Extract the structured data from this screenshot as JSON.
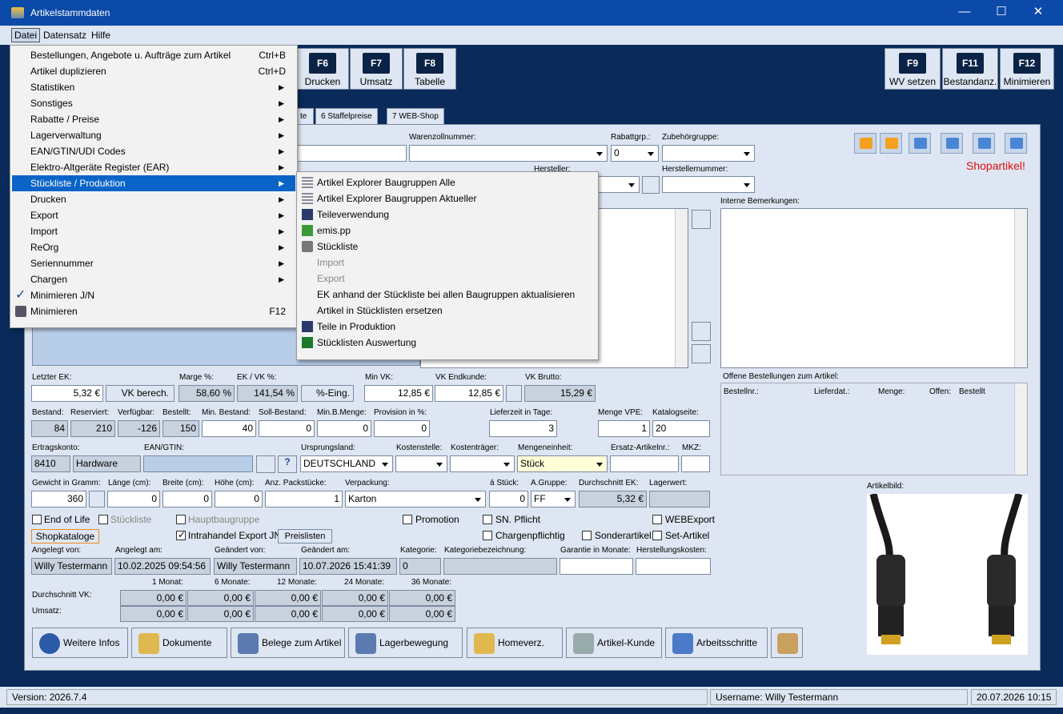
{
  "window": {
    "title": "Artikelstammdaten",
    "minimize": "—",
    "maximize": "☐",
    "close": "✕"
  },
  "menubar": {
    "datei": "Datei",
    "datensatz": "Datensatz",
    "hilfe": "Hilfe"
  },
  "fkeys": [
    {
      "key": "F6",
      "label": "Drucken"
    },
    {
      "key": "F7",
      "label": "Umsatz"
    },
    {
      "key": "F8",
      "label": "Tabelle"
    },
    {
      "key": "F9",
      "label": "WV setzen"
    },
    {
      "key": "F11",
      "label": "Bestandanz."
    },
    {
      "key": "F12",
      "label": "Minimieren"
    }
  ],
  "tabs": [
    "te",
    "6 Staffelpreise",
    "7 WEB-Shop"
  ],
  "shopflag": "Shopartikel!",
  "labels": {
    "warenzoll": "Warenzollnummer:",
    "rabattgrp": "Rabattgrp.:",
    "zubehoer": "Zubehörgruppe:",
    "hersteller": "Hersteller:",
    "herstellernr": "Herstellernummer:",
    "interne": "Interne Bemerkungen:",
    "offene": "Offene Bestellungen zum Artikel:",
    "letzter_ek": "Letzter EK:",
    "marge": "Marge %:",
    "ekvk": "EK / VK %:",
    "minvk": "Min VK:",
    "vkend": "VK Endkunde:",
    "vkbrutto": "VK Brutto:",
    "bestand": "Bestand:",
    "reserviert": "Reserviert:",
    "verfuegbar": "Verfügbar:",
    "bestellt": "Bestellt:",
    "minbestand": "Min. Bestand:",
    "sollbestand": "Soll-Bestand:",
    "minbmenge": "Min.B.Menge:",
    "provision": "Provision in %:",
    "lieferzeit": "Lieferzeit in Tage:",
    "mengevpe": "Menge VPE:",
    "katalogseite": "Katalogseite:",
    "ertragskonto": "Ertragskonto:",
    "ean": "EAN/GTIN:",
    "ursprung": "Ursprungsland:",
    "kostenstelle": "Kostenstelle:",
    "kostentraeger": "Kostenträger:",
    "mengeneinheit": "Mengeneinheit:",
    "ersatz": "Ersatz-Artikelnr.:",
    "mkz": "MKZ:",
    "gewicht": "Gewicht in Gramm:",
    "laenge": "Länge (cm):",
    "breite": "Breite (cm):",
    "hoehe": "Höhe (cm):",
    "packstuecke": "Anz. Packstücke:",
    "verpackung": "Verpackung:",
    "astueck": "á Stück:",
    "agruppe": "A.Gruppe:",
    "durchschnitt": "Durchschnitt EK:",
    "lagerwert": "Lagerwert:",
    "artikelbild": "Artikelbild:",
    "angelegtvon": "Angelegt von:",
    "angelegtam": "Angelegt am:",
    "geaendertvon": "Geändert von:",
    "geaendertam": "Geändert am:",
    "kategorie": "Kategorie:",
    "katbez": "Kategoriebezeichnung:",
    "garantie": "Garantie in Monate:",
    "herstkosten": "Herstellungskosten:",
    "m1": "1 Monat:",
    "m6": "6 Monate:",
    "m12": "12 Monate:",
    "m24": "24 Monate:",
    "m36": "36 Monate:",
    "dvk": "Durchschnitt VK:",
    "umsatz": "Umsatz:"
  },
  "values": {
    "rabatt": "0",
    "letzter_ek": "5,32 €",
    "marge": "58,60 %",
    "ekvk": "141,54 %",
    "minvk": "12,85 €",
    "vkend": "12,85 €",
    "vkbrutto": "15,29 €",
    "bestand": "84",
    "reserviert": "210",
    "verfuegbar": "-126",
    "bestellt": "150",
    "minbestand": "40",
    "sollbestand": "0",
    "minbmenge": "0",
    "provision": "0",
    "lieferzeit": "3",
    "mengevpe": "1",
    "katalogseite": "20",
    "konto": "8410",
    "kontoname": "Hardware",
    "ursprung": "DEUTSCHLAND",
    "mengeneinheit": "Stück",
    "gewicht": "360",
    "laenge": "0",
    "breite": "0",
    "hoehe": "0",
    "packstuecke": "1",
    "verpackung": "Karton",
    "astueck": "0",
    "agruppe": "FF",
    "durchschnitt": "5,32 €",
    "angelegtvon": "Willy Testermann",
    "angelegtam": "10.02.2025 09:54:56",
    "geaendertvon": "Willy Testermann",
    "geaendertam": "10.07.2026 15:41:39",
    "kategorie": "0",
    "euro0": "0,00 €"
  },
  "buttons": {
    "vkberech": "VK berech.",
    "eing": "%-Eing.",
    "shopkataloge": "Shopkataloge",
    "preislisten": "Preislisten"
  },
  "checks": {
    "eol": "End of Life",
    "stueckliste": "Stückliste",
    "hauptbaugruppe": "Hauptbaugruppe",
    "intrahandel": "Intrahandel Export JN",
    "promotion": "Promotion",
    "snpflicht": "SN. Pflicht",
    "chargen": "Chargenpflichtig",
    "sonder": "Sonderartikel",
    "webexport": "WEBExport",
    "set": "Set-Artikel"
  },
  "offene_cols": [
    "Bestellnr.:",
    "Lieferdat.:",
    "Menge:",
    "Offen:",
    "Bestellt"
  ],
  "bottom": [
    "Weitere Infos",
    "Dokumente",
    "Belege zum Artikel",
    "Lagerbewegung",
    "Homeverz.",
    "Artikel-Kunde",
    "Arbeitsschritte"
  ],
  "status": {
    "version": "Version: 2026.7.4",
    "user": "Username: Willy Testermann",
    "datetime": "20.07.2026 10:15"
  },
  "datei_menu": [
    {
      "label": "Bestellungen, Angebote u. Aufträge zum Artikel",
      "sc": "Ctrl+B"
    },
    {
      "label": "Artikel duplizieren",
      "sc": "Ctrl+D"
    },
    {
      "label": "Statistiken",
      "sub": true
    },
    {
      "label": "Sonstiges",
      "sub": true
    },
    {
      "label": "Rabatte / Preise",
      "sub": true
    },
    {
      "label": "Lagerverwaltung",
      "sub": true
    },
    {
      "label": "EAN/GTIN/UDI Codes",
      "sub": true
    },
    {
      "label": "Elektro-Altgeräte Register (EAR)",
      "sub": true
    },
    {
      "label": "Stückliste / Produktion",
      "sub": true,
      "sel": true
    },
    {
      "label": "Drucken",
      "sub": true
    },
    {
      "label": "Export",
      "sub": true
    },
    {
      "label": "Import",
      "sub": true
    },
    {
      "label": "ReOrg",
      "sub": true
    },
    {
      "label": "Seriennummer",
      "sub": true
    },
    {
      "label": "Chargen",
      "sub": true
    },
    {
      "label": "Minimieren J/N",
      "check": true
    },
    {
      "label": "Minimieren",
      "sc": "F12",
      "icon": true
    }
  ],
  "sub_menu": [
    {
      "label": "Artikel Explorer Baugruppen Alle",
      "icon": "grid"
    },
    {
      "label": "Artikel Explorer Baugruppen Aktueller",
      "icon": "grid"
    },
    {
      "label": "Teileverwendung",
      "icon": "doc"
    },
    {
      "label": "emis.pp",
      "icon": "green"
    },
    {
      "label": "Stückliste",
      "icon": "print"
    },
    {
      "label": "Import",
      "dis": true
    },
    {
      "label": "Export",
      "dis": true
    },
    {
      "label": "EK anhand der Stückliste bei allen Baugruppen aktualisieren"
    },
    {
      "label": "Artikel in Stücklisten ersetzen"
    },
    {
      "label": "Teile in Produktion",
      "icon": "doc"
    },
    {
      "label": "Stücklisten Auswertung",
      "icon": "xls"
    }
  ]
}
